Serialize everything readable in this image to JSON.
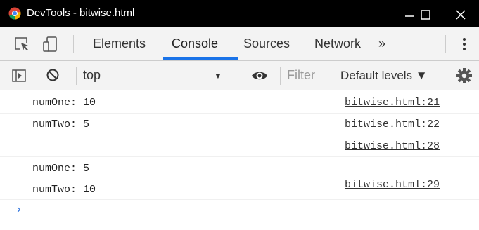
{
  "window": {
    "title": "DevTools - bitwise.html",
    "controls": {
      "minimize": "minimize-icon",
      "maximize": "maximize-icon",
      "close": "close-icon"
    }
  },
  "tabs": {
    "tools": [
      "inspect-element-icon",
      "device-toggle-icon"
    ],
    "items": [
      {
        "label": "Elements",
        "active": false
      },
      {
        "label": "Console",
        "active": true
      },
      {
        "label": "Sources",
        "active": false
      },
      {
        "label": "Network",
        "active": false
      }
    ],
    "more": "»",
    "accent_color": "#1a73e8"
  },
  "toolbar": {
    "context": "top",
    "filter_placeholder": "Filter",
    "levels": "Default levels ▼",
    "icons": [
      "sidebar-toggle-icon",
      "clear-console-icon",
      "eye-icon",
      "settings-gear-icon"
    ]
  },
  "console": {
    "messages": [
      {
        "text": "numOne: 10",
        "source": "bitwise.html:21"
      },
      {
        "text": "numTwo: 5",
        "source": "bitwise.html:22"
      },
      {
        "text": "",
        "source": "bitwise.html:28"
      },
      {
        "text": "numOne: 5",
        "source": ""
      },
      {
        "text": "numTwo: 10",
        "source": "bitwise.html:29"
      }
    ],
    "prompt": "›"
  }
}
